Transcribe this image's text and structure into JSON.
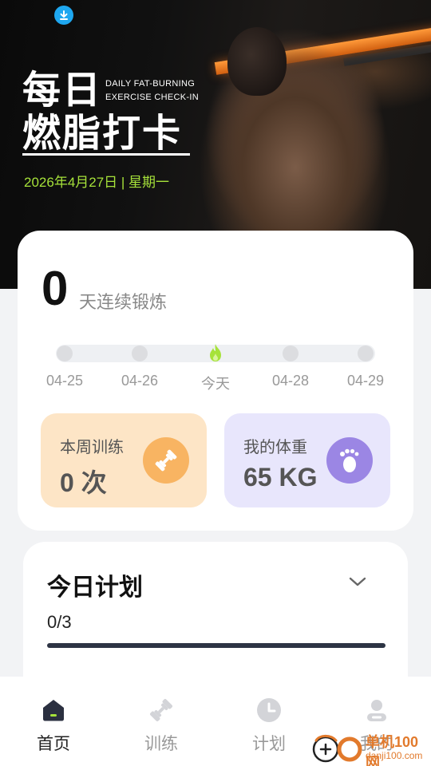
{
  "hero": {
    "title_line1": "每日",
    "title_line2": "燃脂打卡",
    "subtitle_line1": "DAILY FAT-BURNING",
    "subtitle_line2": "EXERCISE CHECK-IN",
    "date": "2026年4月27日 | 星期一"
  },
  "streak": {
    "count": "0",
    "label": "天连续锻炼",
    "days": [
      "04-25",
      "04-26",
      "今天",
      "04-28",
      "04-29"
    ],
    "today_index": 2
  },
  "stats": {
    "week_label": "本周训练",
    "week_value": "0 次",
    "weight_label": "我的体重",
    "weight_value": "65 KG"
  },
  "plan": {
    "title": "今日计划",
    "progress_text": "0/3",
    "progress_fraction": 0
  },
  "tabs": [
    {
      "label": "首页",
      "icon": "home-icon",
      "active": true
    },
    {
      "label": "训练",
      "icon": "dumbbell-icon",
      "active": false
    },
    {
      "label": "计划",
      "icon": "clock-icon",
      "active": false
    },
    {
      "label": "我的",
      "icon": "profile-icon",
      "active": false
    }
  ],
  "watermark": {
    "brand": "单机100网",
    "url": "danji100.com"
  },
  "colors": {
    "accent_green": "#a6e23a",
    "week_card": "#fde5c6",
    "weight_card": "#e8e6fc",
    "week_icon": "#f8b462",
    "weight_icon": "#9b86e4"
  }
}
